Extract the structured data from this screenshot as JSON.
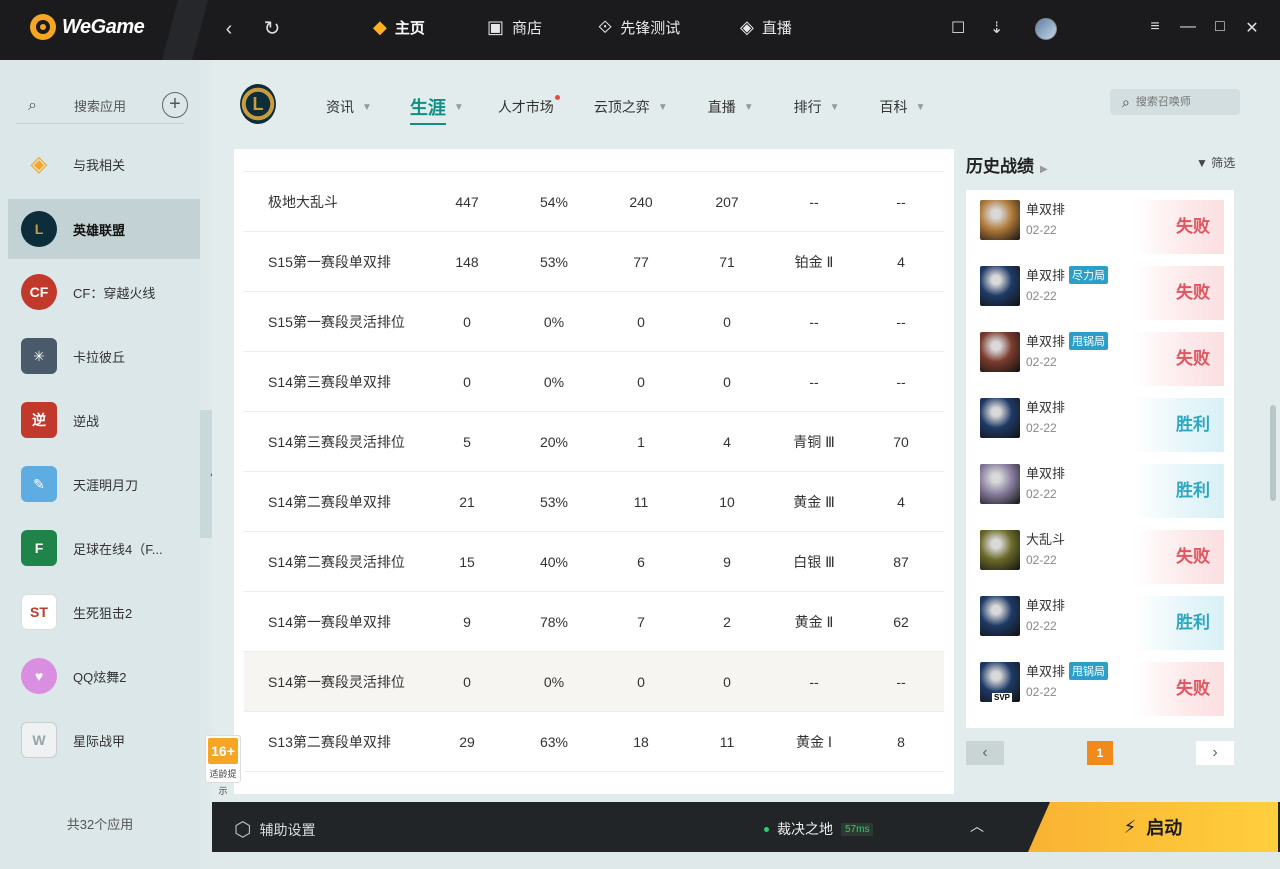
{
  "topbar": {
    "brand": "WeGame",
    "nav": [
      {
        "label": "主页",
        "icon": "game-pad-icon",
        "active": true
      },
      {
        "label": "商店",
        "icon": "shop-bag-icon",
        "active": false
      },
      {
        "label": "先锋测试",
        "icon": "test-icon",
        "active": false
      },
      {
        "label": "直播",
        "icon": "live-icon",
        "active": false
      }
    ]
  },
  "sidebar": {
    "search_label": "搜索应用",
    "items": [
      {
        "label": "与我相关",
        "icon": "related-icon",
        "color": "#f5a623"
      },
      {
        "label": "英雄联盟",
        "icon": "lol-icon",
        "color": "#0d2d3a",
        "active": true
      },
      {
        "label": "CF：穿越火线",
        "icon": "cf-icon",
        "color": "#c0392b"
      },
      {
        "label": "卡拉彼丘",
        "icon": "karapichu-icon",
        "color": "#4a5a6a"
      },
      {
        "label": "逆战",
        "icon": "nizhan-icon",
        "color": "#c0392b"
      },
      {
        "label": "天涯明月刀",
        "icon": "tianya-icon",
        "color": "#5dade2"
      },
      {
        "label": "足球在线4（F...",
        "icon": "fifa-icon",
        "color": "#1e8449"
      },
      {
        "label": "生死狙击2",
        "icon": "sniper-icon",
        "color": "#c0392b"
      },
      {
        "label": "QQ炫舞2",
        "icon": "dance-icon",
        "color": "#d98ee0"
      },
      {
        "label": "星际战甲",
        "icon": "warframe-icon",
        "color": "#95a5a6"
      }
    ],
    "count": "共32个应用",
    "age": {
      "rating": "16+",
      "note": "适龄提示"
    }
  },
  "header": {
    "tabs": [
      {
        "label": "资讯",
        "chevron": true
      },
      {
        "label": "生涯",
        "chevron": true,
        "active": true
      },
      {
        "label": "人才市场",
        "dot": true
      },
      {
        "label": "云顶之弈",
        "chevron": true
      },
      {
        "label": "直播",
        "chevron": true
      },
      {
        "label": "排行",
        "chevron": true
      },
      {
        "label": "百科",
        "chevron": true
      }
    ],
    "search_placeholder": "搜索召唤师"
  },
  "stats": {
    "rows": [
      {
        "name": "极地大乱斗",
        "total": "447",
        "rate": "54%",
        "wins": "240",
        "losses": "207",
        "tier": "--",
        "points": "--"
      },
      {
        "name": "S15第一赛段单双排",
        "total": "148",
        "rate": "53%",
        "wins": "77",
        "losses": "71",
        "tier": "铂金 Ⅱ",
        "points": "4"
      },
      {
        "name": "S15第一赛段灵活排位",
        "total": "0",
        "rate": "0%",
        "wins": "0",
        "losses": "0",
        "tier": "--",
        "points": "--"
      },
      {
        "name": "S14第三赛段单双排",
        "total": "0",
        "rate": "0%",
        "wins": "0",
        "losses": "0",
        "tier": "--",
        "points": "--"
      },
      {
        "name": "S14第三赛段灵活排位",
        "total": "5",
        "rate": "20%",
        "wins": "1",
        "losses": "4",
        "tier": "青铜 Ⅲ",
        "points": "70"
      },
      {
        "name": "S14第二赛段单双排",
        "total": "21",
        "rate": "53%",
        "wins": "11",
        "losses": "10",
        "tier": "黄金 Ⅲ",
        "points": "4"
      },
      {
        "name": "S14第二赛段灵活排位",
        "total": "15",
        "rate": "40%",
        "wins": "6",
        "losses": "9",
        "tier": "白银 Ⅲ",
        "points": "87"
      },
      {
        "name": "S14第一赛段单双排",
        "total": "9",
        "rate": "78%",
        "wins": "7",
        "losses": "2",
        "tier": "黄金 Ⅱ",
        "points": "62"
      },
      {
        "name": "S14第一赛段灵活排位",
        "total": "0",
        "rate": "0%",
        "wins": "0",
        "losses": "0",
        "tier": "--",
        "points": "--",
        "highlight": true
      },
      {
        "name": "S13第二赛段单双排",
        "total": "29",
        "rate": "63%",
        "wins": "18",
        "losses": "11",
        "tier": "黄金 Ⅰ",
        "points": "8"
      }
    ]
  },
  "history": {
    "title": "历史战绩",
    "filter": "筛选",
    "matches": [
      {
        "mode": "单双排",
        "date": "02-22",
        "result": "失败",
        "outcome": "loss",
        "champ_color": "#b07a3a"
      },
      {
        "mode": "单双排",
        "tag": "尽力局",
        "date": "02-22",
        "result": "失败",
        "outcome": "loss",
        "champ_color": "#1f3a66"
      },
      {
        "mode": "单双排",
        "tag": "甩锅局",
        "date": "02-22",
        "result": "失败",
        "outcome": "loss",
        "champ_color": "#7a3b2e"
      },
      {
        "mode": "单双排",
        "date": "02-22",
        "result": "胜利",
        "outcome": "win",
        "champ_color": "#1f3a66"
      },
      {
        "mode": "单双排",
        "date": "02-22",
        "result": "胜利",
        "outcome": "win",
        "champ_color": "#8a7fa0"
      },
      {
        "mode": "大乱斗",
        "date": "02-22",
        "result": "失败",
        "outcome": "loss",
        "champ_color": "#6b6a2a"
      },
      {
        "mode": "单双排",
        "date": "02-22",
        "result": "胜利",
        "outcome": "win",
        "champ_color": "#1f3a66"
      },
      {
        "mode": "单双排",
        "tag": "甩锅局",
        "date": "02-22",
        "result": "失败",
        "outcome": "loss",
        "champ_color": "#1f3a66",
        "badge": "SVP"
      }
    ],
    "page": "1"
  },
  "bottombar": {
    "assist": "辅助设置",
    "server": "裁决之地",
    "ping": "57ms",
    "launch": "启动"
  }
}
